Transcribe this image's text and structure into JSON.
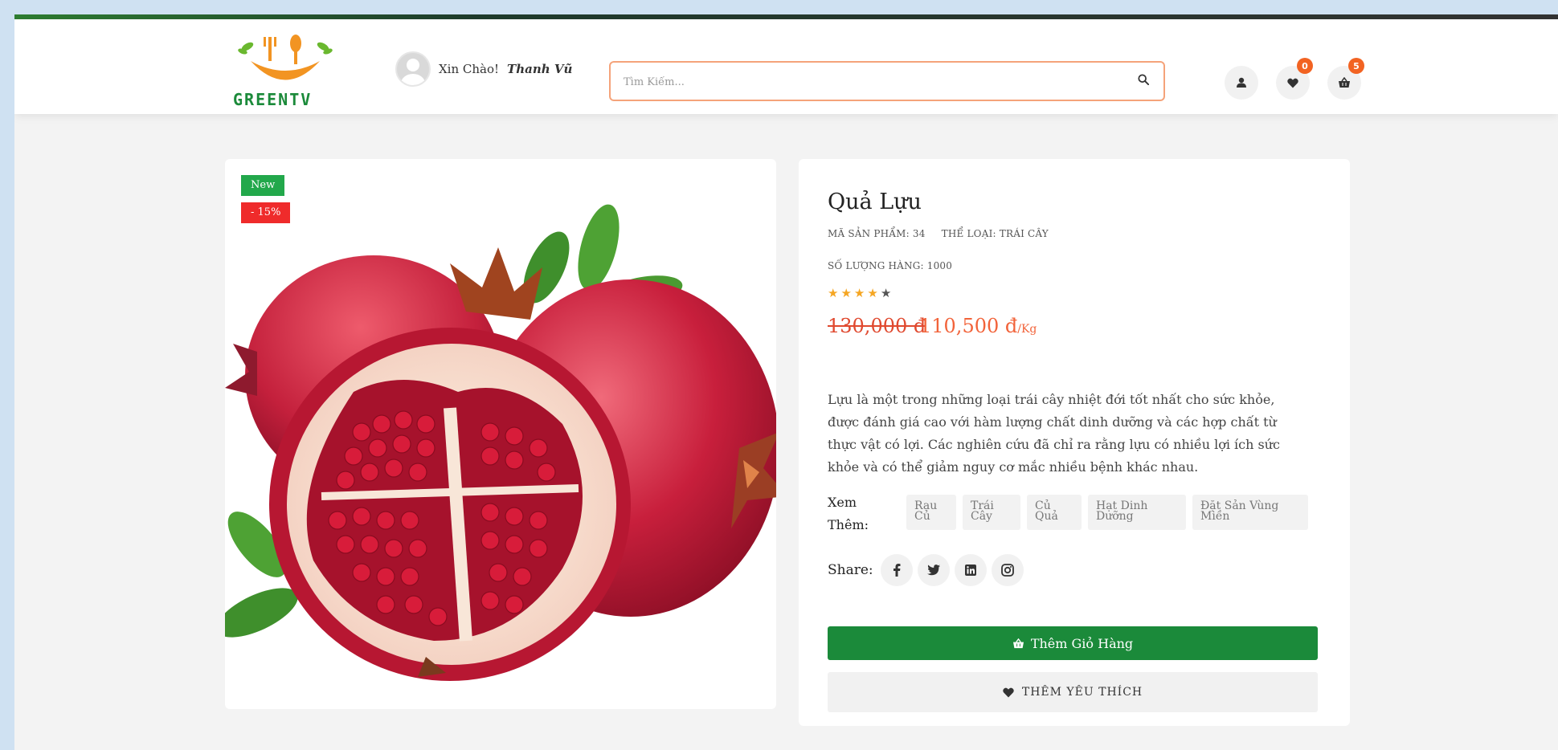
{
  "header": {
    "logo_text": "GREENTV",
    "greeting": "Xin Chào!",
    "user_name": "Thanh Vũ",
    "search_placeholder": "Tìm Kiếm...",
    "wishlist_count": "0",
    "cart_count": "5",
    "icons": [
      "user-icon",
      "heart-icon",
      "basket-icon",
      "search-icon"
    ]
  },
  "product": {
    "badge_new": "New",
    "badge_sale": "- 15%",
    "title": "Quả Lựu",
    "sku": "MÃ SẢN PHẨM: 34",
    "category": "THỂ LOẠI: TRÁI CÂY",
    "stock": "SỐ LƯỢNG HÀNG: 1000",
    "rating": 4,
    "rating_max": 5,
    "price_old": "130,000 đ",
    "price_new": "110,500 đ",
    "price_unit": "/Kg",
    "description": "Lựu là một trong những loại trái cây nhiệt đới tốt nhất cho sức khỏe, được đánh giá cao với hàm lượng chất dinh dưỡng và các hợp chất từ thực vật có lợi. Các nghiên cứu đã chỉ ra rằng lựu có nhiều lợi ích sức khỏe và có thể giảm nguy cơ mắc nhiều bệnh khác nhau.",
    "more_label": "Xem Thêm:",
    "tags": [
      {
        "label": "Rau Củ"
      },
      {
        "label": "Trái Cây"
      },
      {
        "label": "Củ Quả"
      },
      {
        "label": "Hạt Dinh Dưỡng"
      },
      {
        "label": "Đặt Sản Vùng Miền"
      }
    ],
    "share_label": "Share:",
    "social": [
      "facebook-icon",
      "twitter-icon",
      "linkedin-icon",
      "instagram-icon"
    ],
    "add_to_cart": "Thêm Giỏ Hàng",
    "add_to_wishlist": "THÊM YÊU THÍCH"
  },
  "colors": {
    "brand_green": "#1b8a3a",
    "accent_orange": "#f2633a",
    "sale_red": "#ef2b2b"
  }
}
